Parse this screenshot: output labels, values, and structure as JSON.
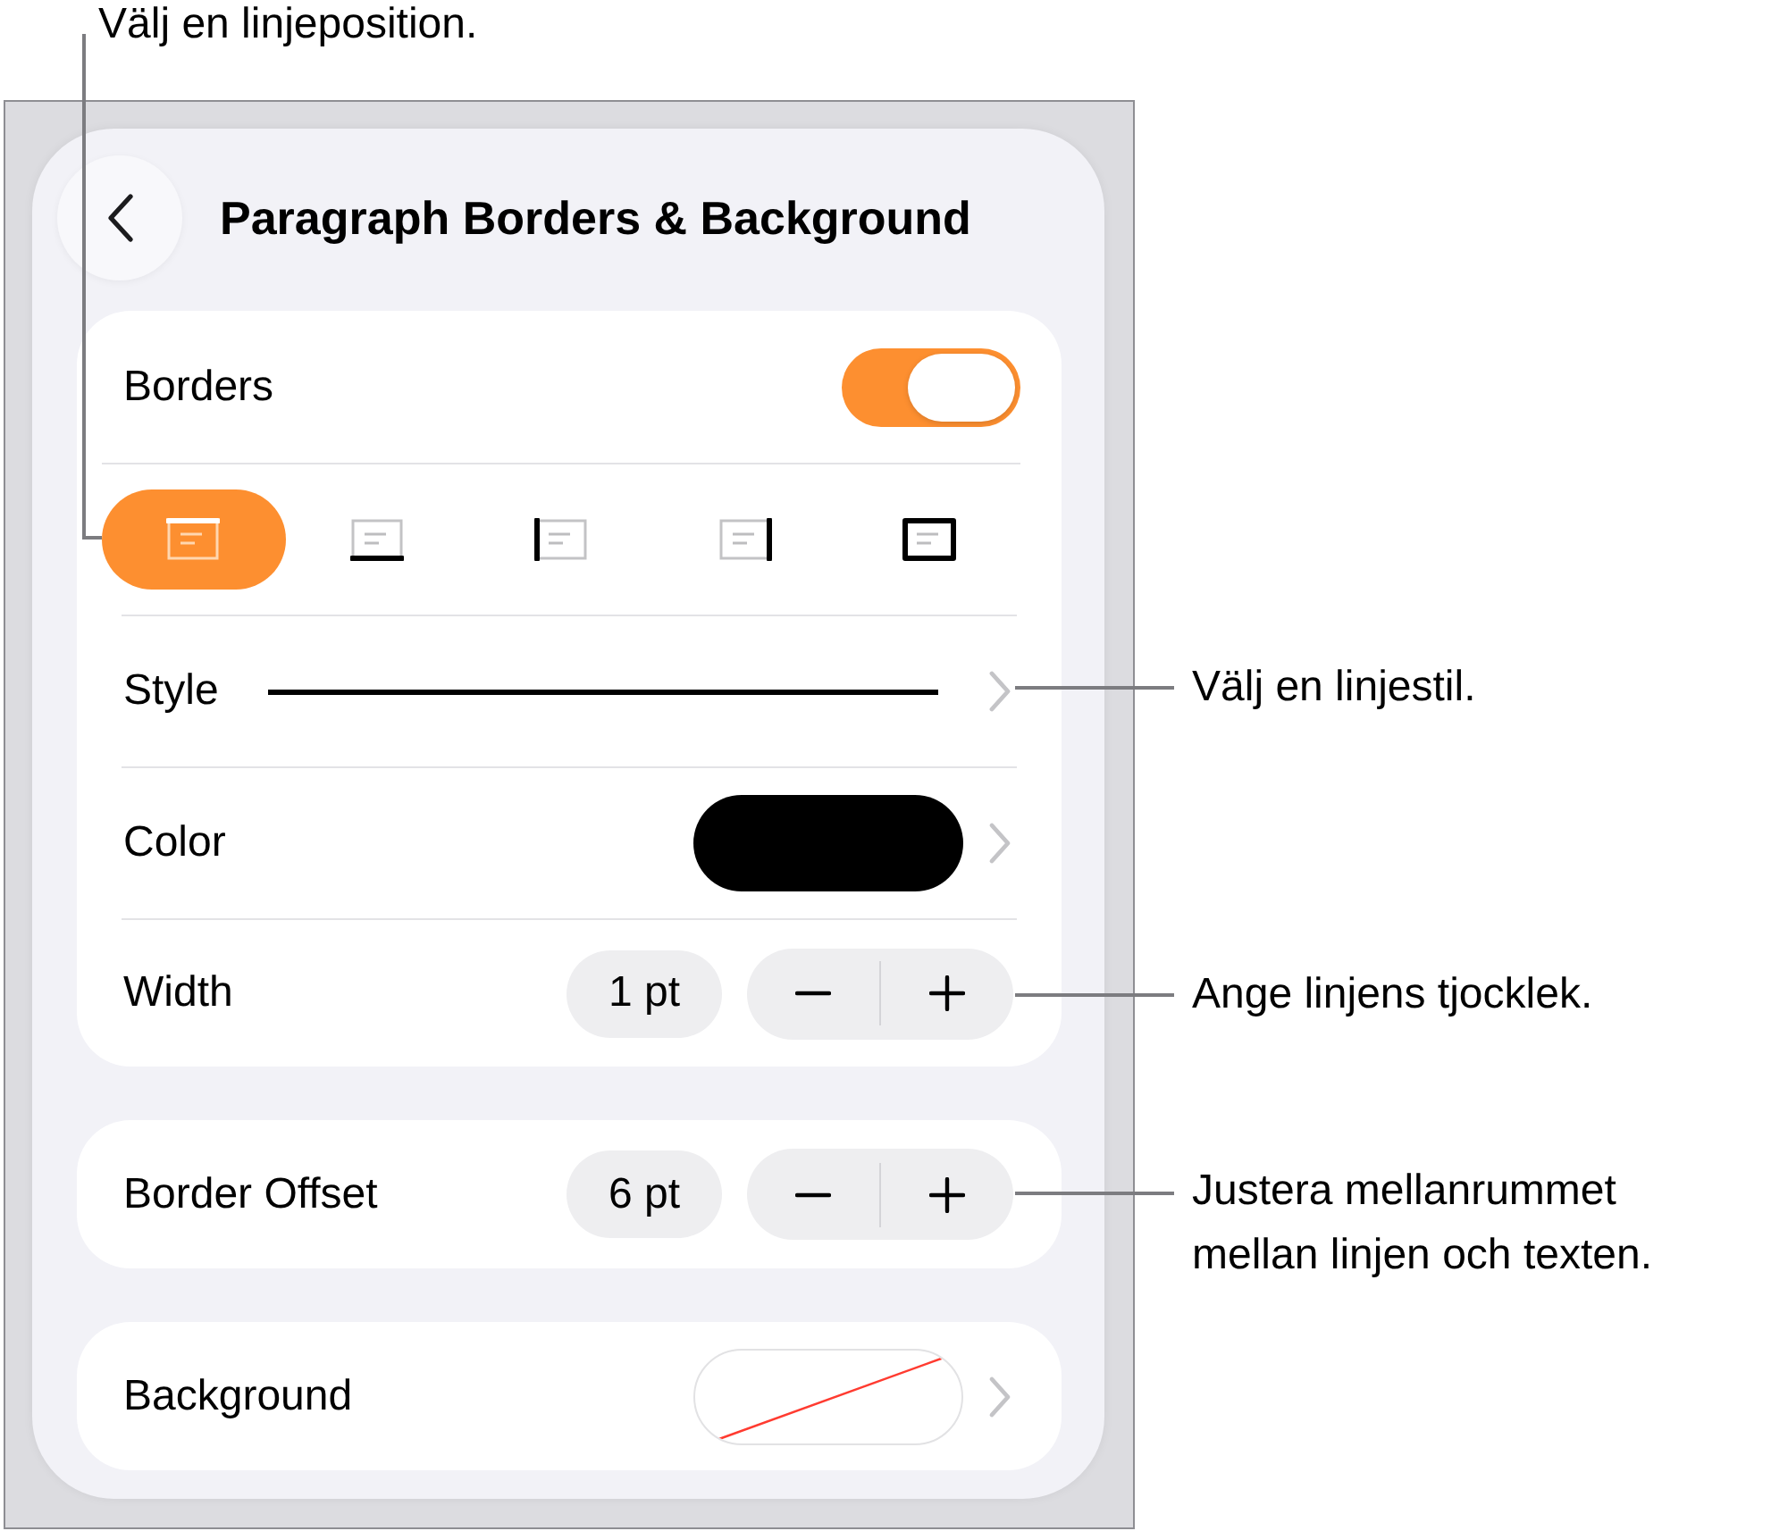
{
  "callouts": [
    {
      "text": "Välj en linjeposition."
    },
    {
      "text": "Välj en linjestil."
    },
    {
      "text": "Ange linjens tjocklek."
    },
    {
      "text": "Justera mellanrummet mellan linjen och texten."
    }
  ],
  "panel": {
    "title": "Paragraph Borders & Background"
  },
  "borders": {
    "label": "Borders",
    "on": true
  },
  "positions": [
    {
      "kind": "top",
      "selected": true
    },
    {
      "kind": "bottom",
      "selected": false
    },
    {
      "kind": "left",
      "selected": false
    },
    {
      "kind": "right",
      "selected": false
    },
    {
      "kind": "box",
      "selected": false
    }
  ],
  "style": {
    "label": "Style"
  },
  "color": {
    "label": "Color",
    "color": "#000000"
  },
  "width": {
    "label": "Width",
    "value": "1 pt"
  },
  "offset": {
    "label": "Border Offset",
    "value": "6 pt"
  },
  "background": {
    "label": "Background",
    "no_fill": true
  }
}
